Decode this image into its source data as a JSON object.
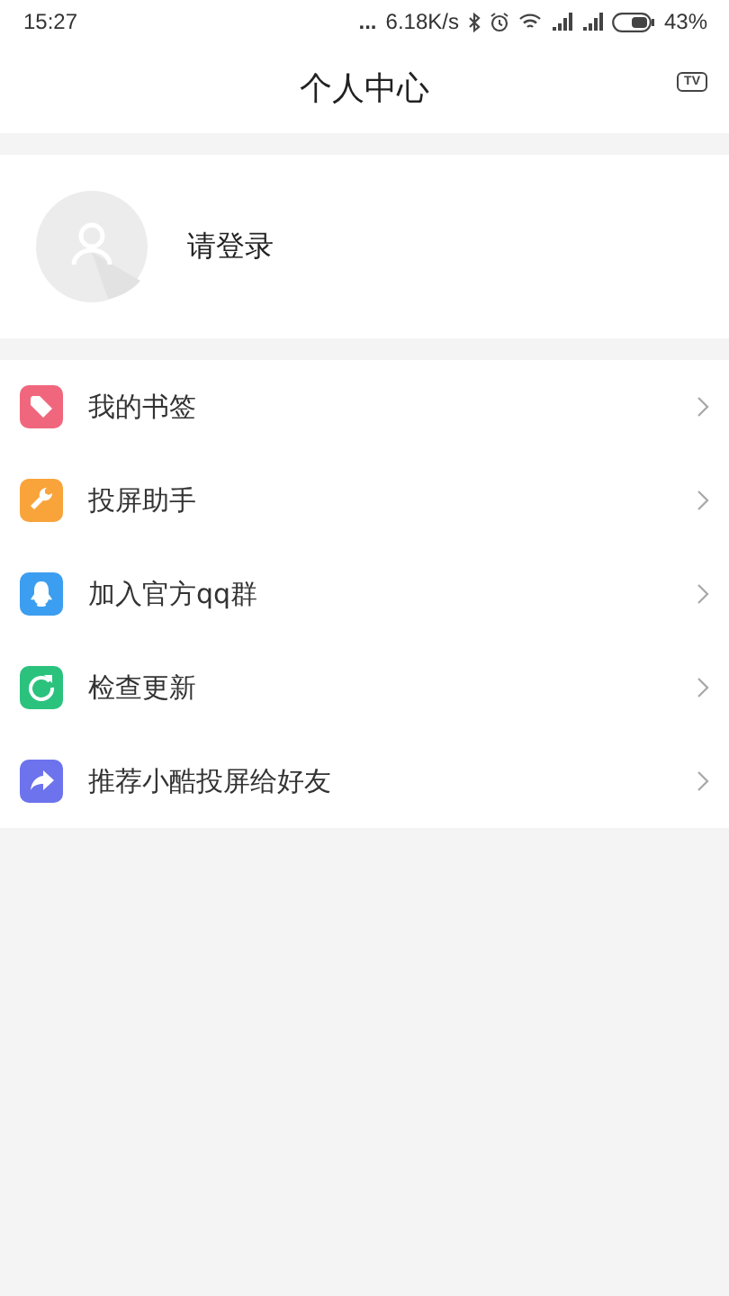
{
  "status_bar": {
    "time": "15:27",
    "more": "...",
    "speed": "6.18K/s",
    "battery": "43%"
  },
  "header": {
    "title": "个人中心",
    "tv_button": "TV"
  },
  "profile": {
    "login": "请登录"
  },
  "menu": [
    {
      "label": "我的书签",
      "kind": "tag",
      "color": "#f0677d"
    },
    {
      "label": "投屏助手",
      "kind": "wrench",
      "color": "#f8a43b"
    },
    {
      "label": "加入官方qq群",
      "kind": "qq",
      "color": "#3c9ef0"
    },
    {
      "label": "检查更新",
      "kind": "refresh",
      "color": "#2bc27e"
    },
    {
      "label": "推荐小酷投屏给好友",
      "kind": "share",
      "color": "#6d73ec"
    }
  ]
}
